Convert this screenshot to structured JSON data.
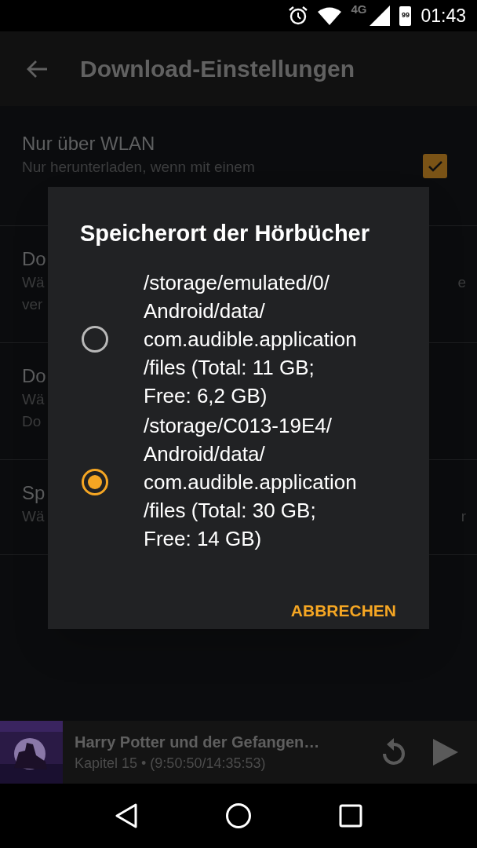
{
  "status_bar": {
    "network": "4G",
    "battery": "99",
    "time": "01:43"
  },
  "app_bar": {
    "title": "Download-Einstellungen"
  },
  "settings": [
    {
      "kind": "checkbox",
      "checked": true,
      "title": "Nur über WLAN",
      "lines": [
        {
          "left": "Nur herunterladen, wenn mit einem"
        }
      ]
    },
    {
      "kind": "plain",
      "title": "Do",
      "lines": [
        {
          "left": "Wä",
          "right": "e"
        },
        {
          "left": "ver"
        }
      ]
    },
    {
      "kind": "plain",
      "title": "Do",
      "lines": [
        {
          "left": "Wä"
        },
        {
          "left": "Do"
        }
      ]
    },
    {
      "kind": "plain",
      "title": "Sp",
      "lines": [
        {
          "left": "Wä",
          "right": "r"
        }
      ]
    }
  ],
  "dialog": {
    "title": "Speicherort der Hörbücher",
    "options": [
      {
        "selected": false,
        "lines": [
          "/storage/emulated/0/",
          "Android/data/",
          "com.audible.application",
          "/files (Total: 11 GB;",
          "Free: 6,2 GB)"
        ]
      },
      {
        "selected": true,
        "lines": [
          "/storage/C013-19E4/",
          "Android/data/",
          "com.audible.application",
          "/files (Total: 30 GB;",
          "Free: 14 GB)"
        ]
      }
    ],
    "button": "ABBRECHEN"
  },
  "player": {
    "title": "Harry Potter und der Gefangen…",
    "subtitle": "Kapitel 15 • (9:50:50/14:35:53)"
  }
}
